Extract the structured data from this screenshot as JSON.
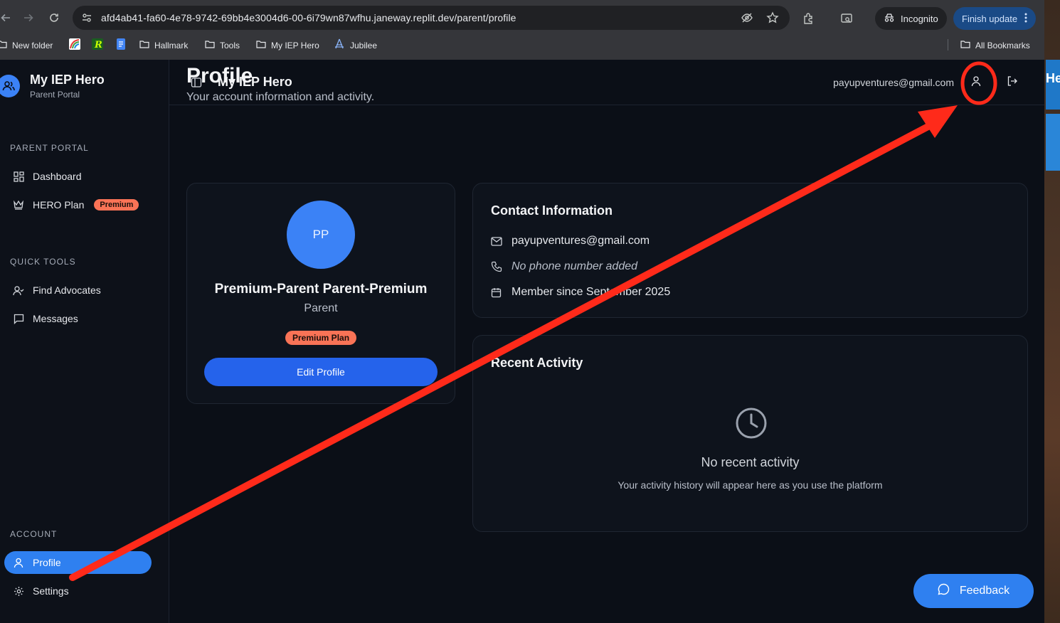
{
  "browser": {
    "url": "afd4ab41-fa60-4e78-9742-69bb4e3004d6-00-6i79wn87wfhu.janeway.replit.dev/parent/profile",
    "incognito_label": "Incognito",
    "finish_update_label": "Finish update",
    "bookmarks": [
      "New folder",
      "Hallmark",
      "Tools",
      "My IEP Hero",
      "Jubilee"
    ],
    "all_bookmarks_label": "All Bookmarks"
  },
  "sidebar": {
    "brand_title": "My IEP Hero",
    "brand_subtitle": "Parent Portal",
    "sections": {
      "parent_portal": "PARENT PORTAL",
      "quick_tools": "QUICK TOOLS",
      "account": "ACCOUNT"
    },
    "items": {
      "dashboard": "Dashboard",
      "hero_plan": "HERO Plan",
      "hero_badge": "Premium",
      "find_advocates": "Find Advocates",
      "messages": "Messages",
      "profile": "Profile",
      "settings": "Settings"
    }
  },
  "topbar": {
    "title": "My IEP Hero",
    "email": "payupventures@gmail.com"
  },
  "page": {
    "title": "Profile",
    "subtitle": "Your account information and activity."
  },
  "profile_card": {
    "initials": "PP",
    "name": "Premium-Parent Parent-Premium",
    "role": "Parent",
    "plan_badge": "Premium Plan",
    "edit_button": "Edit Profile"
  },
  "contact": {
    "title": "Contact Information",
    "email": "payupventures@gmail.com",
    "phone": "No phone number added",
    "member_since": "Member since September 2025"
  },
  "activity": {
    "title": "Recent Activity",
    "empty_title": "No recent activity",
    "empty_hint": "Your activity history will appear here as you use the platform"
  },
  "feedback_label": "Feedback",
  "desktop_label": "He",
  "colors": {
    "accent": "#2f80f0",
    "premium": "#f97356",
    "annotation": "#ff2a1a"
  }
}
